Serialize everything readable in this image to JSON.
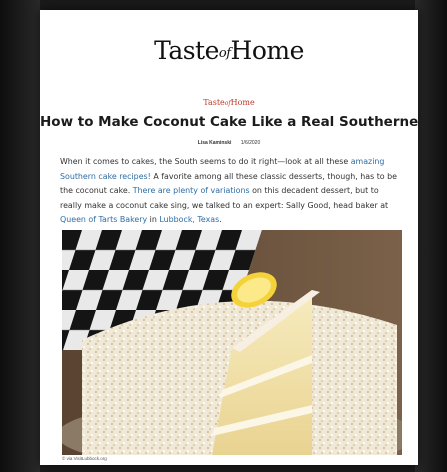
{
  "brand": {
    "masthead_pre": "Taste",
    "masthead_of": "of",
    "masthead_post": "Home",
    "subbrand_pre": "Taste",
    "subbrand_of": "of",
    "subbrand_post": "Home"
  },
  "article": {
    "title": "How to Make Coconut Cake Like a Real Southerner",
    "author": "Lisa Kaminski",
    "date": "1/6/2020",
    "body": [
      {
        "text": "When it comes to cakes, the South seems to do it right—look at all these ",
        "link": false
      },
      {
        "text": "amazing Southern cake recipes!",
        "link": true
      },
      {
        "text": " A favorite among all these classic desserts, though, has to be the coconut cake. ",
        "link": false
      },
      {
        "text": "There are plenty of variations",
        "link": true
      },
      {
        "text": " on this decadent dessert, but to really make a coconut cake sing, we talked to an expert: Sally Good, head baker at ",
        "link": false
      },
      {
        "text": "Queen of Tarts Bakery",
        "link": true
      },
      {
        "text": " in ",
        "link": false
      },
      {
        "text": "Lubbock, Texas",
        "link": true
      },
      {
        "text": ".",
        "link": false
      }
    ],
    "photo_credit": "© via VisitLubbock.org"
  },
  "colors": {
    "link": "#2e6da4",
    "brand_red": "#c0392b",
    "frosting": "#f3ecde",
    "cake_crumb": "#f5e7b0"
  }
}
